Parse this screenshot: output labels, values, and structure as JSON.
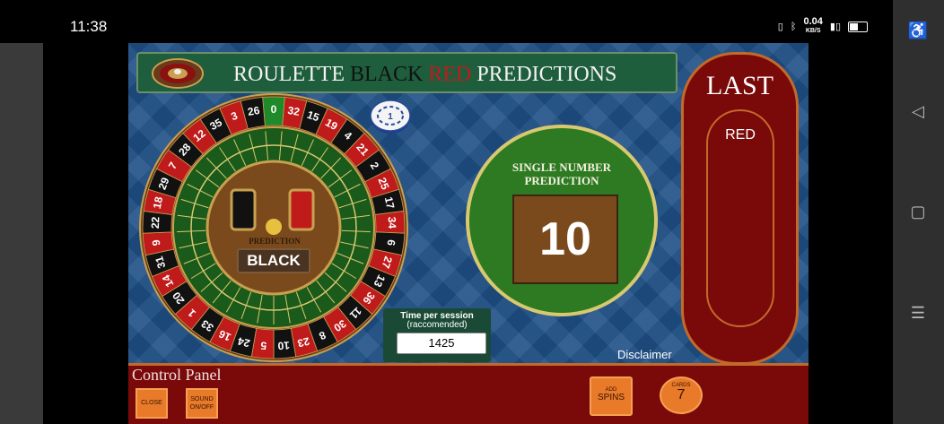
{
  "status_bar": {
    "time": "11:38",
    "net_speed": "0.04",
    "net_unit": "KB/S"
  },
  "app": {
    "title": {
      "part1": "ROULETTE ",
      "part2": "BLACK",
      "part3": " RED",
      "part4": " PREDICTIONS"
    },
    "wheel": {
      "numbers": [
        "0",
        "32",
        "15",
        "19",
        "4",
        "21",
        "2",
        "25",
        "17",
        "34",
        "6",
        "27",
        "13",
        "36",
        "11",
        "30",
        "8",
        "23",
        "10",
        "5",
        "24",
        "16",
        "33",
        "1",
        "20",
        "14",
        "31",
        "9",
        "22",
        "18",
        "29",
        "7",
        "28",
        "12",
        "35",
        "3",
        "26"
      ],
      "prediction_label": "PREDICTION",
      "prediction_value": "BLACK"
    },
    "chip_value": "1",
    "single_number": {
      "label": "SINGLE NUMBER PREDICTION",
      "value": "10"
    },
    "last": {
      "title": "LAST",
      "value": "RED"
    },
    "session": {
      "label": "Time per session",
      "sublabel": "(raccomended)",
      "value": "1425"
    },
    "disclaimer": "Disclaimer",
    "control_panel": {
      "title": "Control Panel",
      "close_label": "CLOSE",
      "sound_label": "SOUND ON/OFF",
      "add_label": "ADD",
      "spins_label": "SPINS",
      "cards_label": "CARDS",
      "cards_value": "7"
    }
  },
  "colors": {
    "felt_green": "#2e7a22",
    "wheel_red": "#c01b1b",
    "panel_red": "#7a0a0a",
    "button_orange": "#e87a2a",
    "background_blue": "#1d4f86"
  }
}
